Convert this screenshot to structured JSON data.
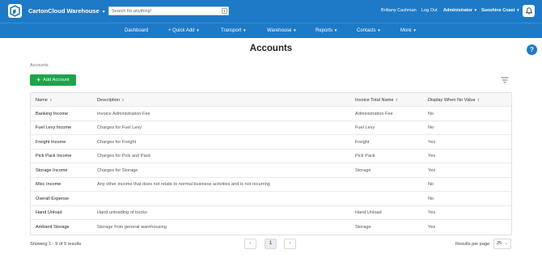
{
  "app": {
    "brand": "CartonCloud Warehouse",
    "search_placeholder": "Search for anything!",
    "user": "Brittany Cashman",
    "logout": "Log Out",
    "role": "Administrator",
    "location": "Sunshine Coast"
  },
  "nav": [
    "Dashboard",
    "+ Quick Add",
    "Transport",
    "Warehouse",
    "Reports",
    "Contacts",
    "More"
  ],
  "page": {
    "title": "Accounts",
    "breadcrumb": "Accounts",
    "add_button": "Add Account"
  },
  "table": {
    "columns": [
      "Name",
      "Description",
      "Invoice Total Name",
      "Display When No Value"
    ],
    "rows": [
      {
        "name": "Banking Income",
        "description": "Invoice Administration Fee",
        "invoice_total": "Administration Fee",
        "display": "No"
      },
      {
        "name": "Fuel Levy Income",
        "description": "Charges for Fuel Levy",
        "invoice_total": "Fuel Levy",
        "display": "No"
      },
      {
        "name": "Freight Income",
        "description": "Charges for Freight",
        "invoice_total": "Freight",
        "display": "Yes"
      },
      {
        "name": "Pick Pack Income",
        "description": "Charges for Pick and Pack",
        "invoice_total": "Pick Pack",
        "display": "Yes"
      },
      {
        "name": "Storage Income",
        "description": "Charges for Storage",
        "invoice_total": "Storage",
        "display": "Yes"
      },
      {
        "name": "Misc Income",
        "description": "Any other income that does not relate to normal business activities and is not recurring",
        "invoice_total": "",
        "display": "No"
      },
      {
        "name": "Overall Expense",
        "description": "",
        "invoice_total": "",
        "display": "No"
      },
      {
        "name": "Hand Unload",
        "description": "Hand unloading of trucks",
        "invoice_total": "Hand Unload",
        "display": "Yes"
      },
      {
        "name": "Ambient Storage",
        "description": "Storage from general warehousing",
        "invoice_total": "Storage",
        "display": "Yes"
      }
    ]
  },
  "footer": {
    "showing": "Showing 1 - 9 of 9 results",
    "prev": "‹",
    "page": "1",
    "next": "›",
    "rpp_label": "Results per page",
    "rpp_value": "25"
  },
  "colors": {
    "primary": "#1e7ac7",
    "success": "#1ea34a"
  },
  "icons": [
    "carton-cloud-logo-icon",
    "search-icon",
    "bell-icon",
    "help-icon",
    "plus-icon",
    "sort-icon",
    "filter-lines-icon"
  ]
}
